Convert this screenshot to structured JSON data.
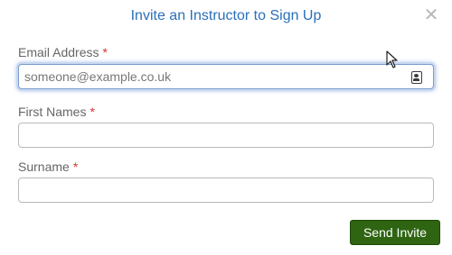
{
  "dialog": {
    "title": "Invite an Instructor to Sign Up",
    "close_glyph": "✕"
  },
  "form": {
    "email": {
      "label": "Email Address",
      "required_mark": "*",
      "value": "",
      "placeholder": "someone@example.co.uk",
      "icon": "contact-card-icon"
    },
    "first_names": {
      "label": "First Names",
      "required_mark": "*",
      "value": "",
      "placeholder": ""
    },
    "surname": {
      "label": "Surname",
      "required_mark": "*",
      "value": "",
      "placeholder": ""
    }
  },
  "actions": {
    "send_label": "Send Invite",
    "send_color": "#2e6412"
  },
  "colors": {
    "title": "#2a6fba",
    "required": "#d9342b",
    "focus_ring": "#b3c7ea"
  }
}
